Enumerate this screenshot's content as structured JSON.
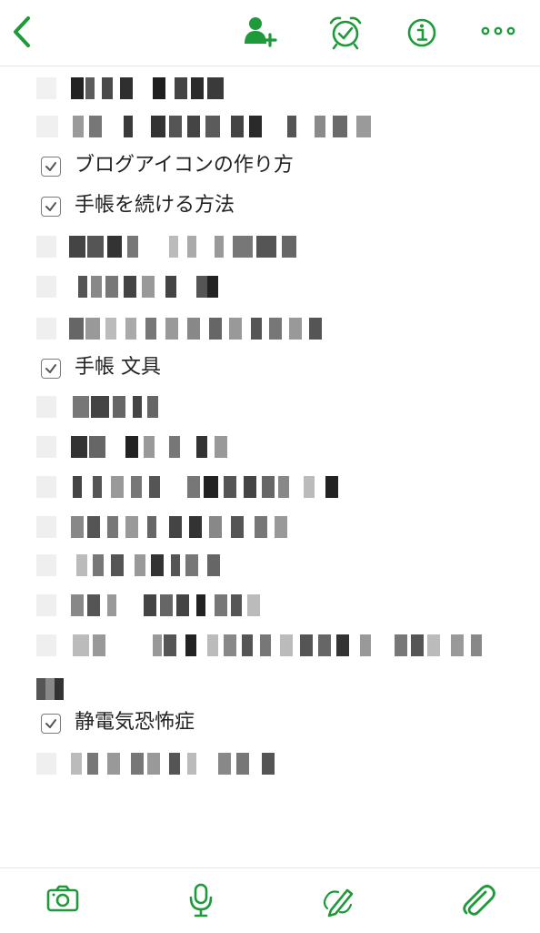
{
  "toolbar": {
    "back_icon": "chevron-left-icon",
    "share_icon": "add-person-icon",
    "reminder_icon": "alarm-clock-icon",
    "info_icon": "info-icon",
    "more_icon": "more-dots-icon",
    "accent_color": "#1f9a3a"
  },
  "checklist": {
    "item_1": "ブログアイコンの作り方",
    "item_2": "手帳を続ける方法",
    "item_3": "手帳 文具",
    "item_4": "静電気恐怖症"
  },
  "redacted_note": "blurred/pixelated text lines (not legible)",
  "bottom_toolbar": {
    "camera_icon": "camera-icon",
    "audio_icon": "microphone-icon",
    "sketch_icon": "pen-sketch-icon",
    "attach_icon": "paperclip-icon"
  }
}
